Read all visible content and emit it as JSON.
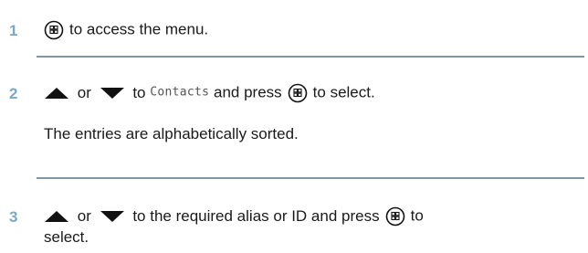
{
  "steps": [
    {
      "number": "1",
      "text_after_icon": "to access the menu."
    },
    {
      "number": "2",
      "or": "or",
      "to": "to",
      "menu_item": "Contacts",
      "and_press": "and press",
      "to_select": "to select.",
      "note": "The entries are alphabetically sorted."
    },
    {
      "number": "3",
      "or": "or",
      "text_mid": "to the required alias or ID and press",
      "to": "to",
      "wrap": "select."
    }
  ],
  "icons": {
    "menu": "menu-ok-button-icon",
    "up": "up-arrow-icon",
    "down": "down-arrow-icon"
  },
  "colors": {
    "step_number": "#7aa9c6",
    "separator": "#7f96a8"
  }
}
